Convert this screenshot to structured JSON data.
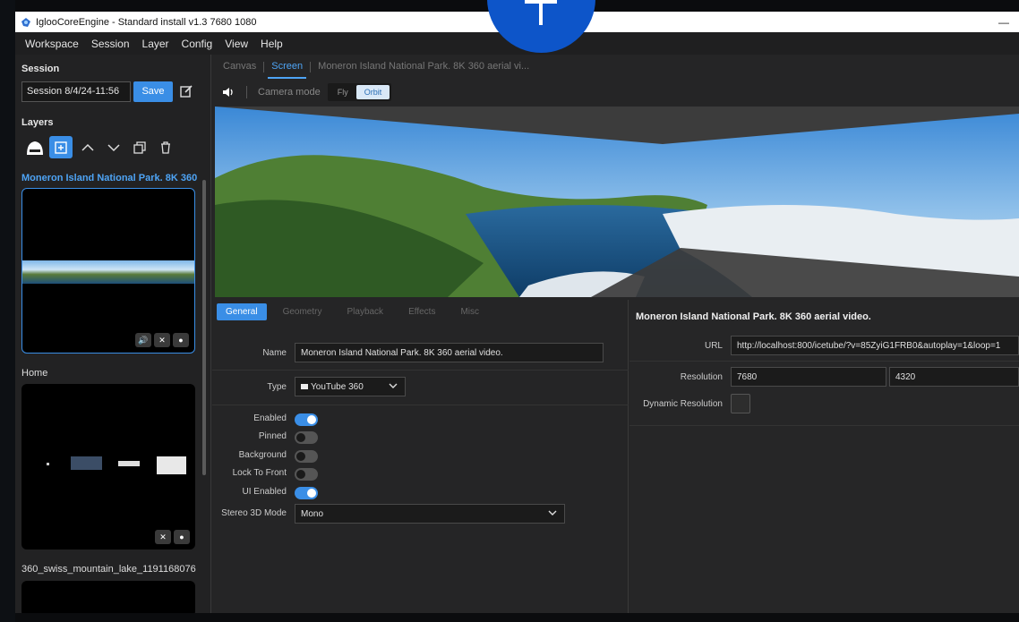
{
  "window": {
    "title": "IglooCoreEngine - Standard install v1.3 7680 1080",
    "minimize": "—"
  },
  "menu": [
    "Workspace",
    "Session",
    "Layer",
    "Config",
    "View",
    "Help"
  ],
  "sidebar": {
    "session_label": "Session",
    "session_value": "Session 8/4/24-11:56",
    "save_label": "Save",
    "layers_label": "Layers",
    "layers": [
      {
        "title": "Moneron Island National Park. 8K 360",
        "selected": true
      },
      {
        "title": "Home",
        "selected": false
      },
      {
        "title": "360_swiss_mountain_lake_1191168076",
        "selected": false
      }
    ]
  },
  "top_tabs": [
    "Canvas",
    "Screen",
    "Moneron Island National Park. 8K 360 aerial vi..."
  ],
  "camera": {
    "label": "Camera mode",
    "modes": [
      "Fly",
      "Orbit"
    ],
    "active": "Orbit"
  },
  "sub_tabs": [
    "General",
    "Geometry",
    "Playback",
    "Effects",
    "Misc"
  ],
  "general": {
    "name_label": "Name",
    "name_value": "Moneron Island National Park. 8K 360 aerial video.",
    "type_label": "Type",
    "type_value": "YouTube 360",
    "toggles": [
      {
        "label": "Enabled",
        "on": true
      },
      {
        "label": "Pinned",
        "on": false
      },
      {
        "label": "Background",
        "on": false
      },
      {
        "label": "Lock To Front",
        "on": false
      },
      {
        "label": "UI Enabled",
        "on": true
      }
    ],
    "stereo_label": "Stereo 3D Mode",
    "stereo_value": "Mono"
  },
  "details": {
    "title": "Moneron Island National Park. 8K 360 aerial video.",
    "url_label": "URL",
    "url_value": "http://localhost:800/icetube/?v=85ZyiG1FRB0&autoplay=1&loop=1",
    "resolution_label": "Resolution",
    "res_w": "7680",
    "res_h": "4320",
    "dynamic_label": "Dynamic Resolution"
  },
  "colors": {
    "accent": "#3a8ee6",
    "accent_text": "#4ea4f5",
    "overlay_circle": "#0d55c9"
  }
}
